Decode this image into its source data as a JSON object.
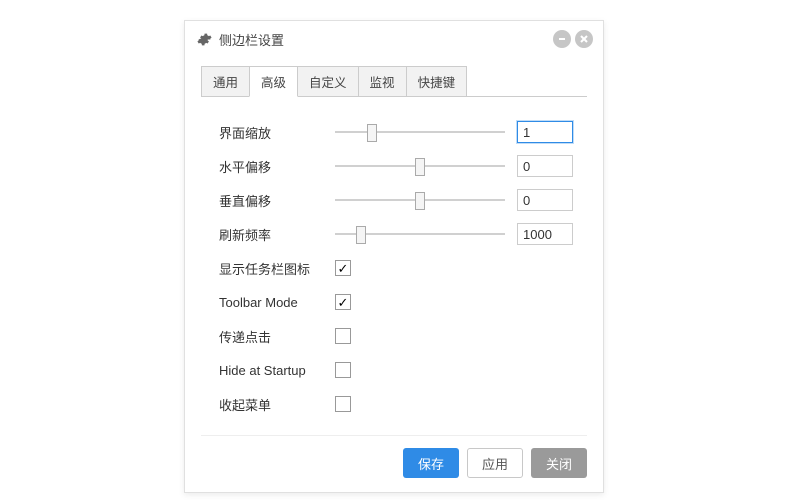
{
  "window": {
    "title": "侧边栏设置"
  },
  "tabs": {
    "general": "通用",
    "advanced": "高级",
    "custom": "自定义",
    "monitor": "监视",
    "hotkeys": "快捷键"
  },
  "sliders": {
    "scale": {
      "label": "界面缩放",
      "value": "1",
      "pos": 22
    },
    "hoff": {
      "label": "水平偏移",
      "value": "0",
      "pos": 50
    },
    "voff": {
      "label": "垂直偏移",
      "value": "0",
      "pos": 50
    },
    "refresh": {
      "label": "刷新频率",
      "value": "1000",
      "pos": 15
    }
  },
  "checks": {
    "show_tray": {
      "label": "显示任务栏图标",
      "on": true
    },
    "toolbar": {
      "label": "Toolbar Mode",
      "on": true
    },
    "passthrough": {
      "label": "传递点击",
      "on": false
    },
    "hide_start": {
      "label": "Hide at Startup",
      "on": false
    },
    "collapse": {
      "label": "收起菜单",
      "on": false
    }
  },
  "buttons": {
    "save": "保存",
    "apply": "应用",
    "close": "关闭"
  }
}
